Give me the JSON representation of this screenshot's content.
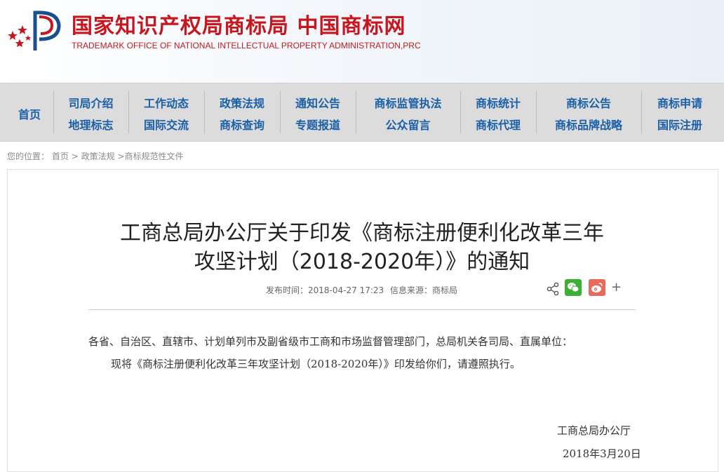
{
  "header": {
    "title_cn": "国家知识产权局商标局 中国商标网",
    "title_en": "TRADEMARK OFFICE OF NATIONAL INTELLECTUAL PROPERTY ADMINISTRATION,PRC",
    "brand_color": "#c8161e"
  },
  "nav": {
    "home": "首页",
    "cols": [
      [
        "司局介绍",
        "地理标志"
      ],
      [
        "工作动态",
        "国际交流"
      ],
      [
        "政策法规",
        "商标查询"
      ],
      [
        "通知公告",
        "专题报道"
      ],
      [
        "商标监管执法",
        "公众留言"
      ],
      [
        "商标统计",
        "商标代理"
      ],
      [
        "商标公告",
        "商标品牌战略"
      ],
      [
        "商标申请",
        "国际注册"
      ]
    ],
    "link_color": "#1a5fa8"
  },
  "breadcrumb": {
    "prefix": "您的位置：",
    "items": [
      "首页",
      "政策法规",
      "商标规范性文件"
    ],
    "sep": ">"
  },
  "article": {
    "title_line1": "工商总局办公厅关于印发《商标注册便利化改革三年",
    "title_line2": "攻坚计划（2018-2020年）》的通知",
    "publish_label": "发布时间：",
    "publish_time": "2018-04-27 17:23",
    "source_label": "信息来源：",
    "source": "商标局",
    "share_plus": "+",
    "para1": "各省、自治区、直辖市、计划单列市及副省级市工商和市场监督管理部门，总局机关各司局、直属单位：",
    "para2": "现将《商标注册便利化改革三年攻坚计划（2018-2020年）》印发给你们，请遵照执行。",
    "signature": "工商总局办公厅",
    "date": "2018年3月20日"
  }
}
